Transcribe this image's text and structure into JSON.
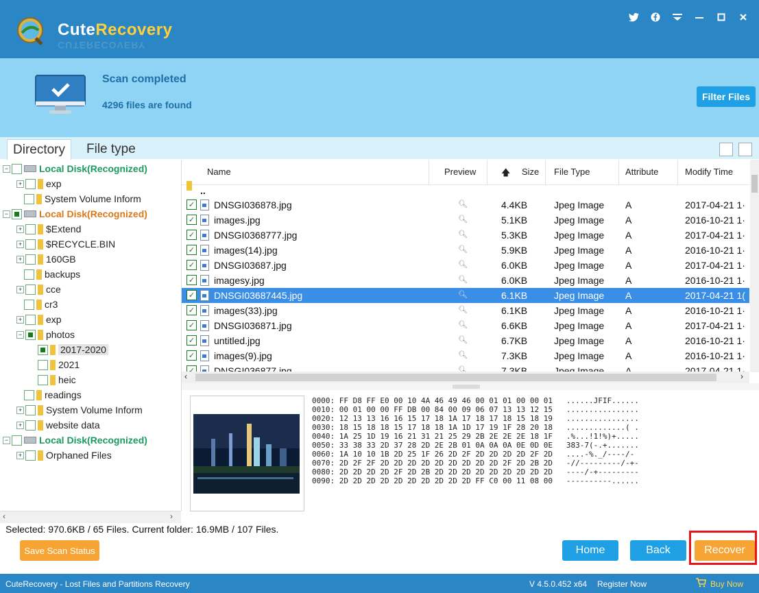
{
  "window": {
    "app_name_part1": "Cute",
    "app_name_part2": "Recovery",
    "app_name_shadow": "CUTERECOVERY",
    "controls": [
      "twitter-icon",
      "facebook-icon",
      "menu-icon",
      "minimize-icon",
      "maximize-icon",
      "close-icon"
    ]
  },
  "scan": {
    "status": "Scan completed",
    "count": "4296 files are found",
    "filter_button": "Filter Files"
  },
  "tabs": {
    "directory": "Directory",
    "file_type": "File type"
  },
  "tree": [
    {
      "label": "Local Disk(Recognized)",
      "kind": "disk",
      "color": "green",
      "indent": 0,
      "exp": "−",
      "check": "none"
    },
    {
      "label": "exp",
      "kind": "folder",
      "indent": 1,
      "exp": "+",
      "check": "none"
    },
    {
      "label": "System Volume Inform",
      "kind": "folder",
      "indent": 1,
      "exp": "",
      "check": "none"
    },
    {
      "label": "Local Disk(Recognized)",
      "kind": "disk",
      "color": "orange",
      "indent": 0,
      "exp": "−",
      "check": "partial"
    },
    {
      "label": "$Extend",
      "kind": "folder",
      "indent": 1,
      "exp": "+",
      "check": "none"
    },
    {
      "label": "$RECYCLE.BIN",
      "kind": "folder",
      "indent": 1,
      "exp": "+",
      "check": "none"
    },
    {
      "label": "160GB",
      "kind": "folder",
      "indent": 1,
      "exp": "+",
      "check": "none"
    },
    {
      "label": "backups",
      "kind": "folder",
      "indent": 1,
      "exp": "",
      "check": "none"
    },
    {
      "label": "cce",
      "kind": "folder",
      "indent": 1,
      "exp": "+",
      "check": "none"
    },
    {
      "label": "cr3",
      "kind": "folder",
      "indent": 1,
      "exp": "",
      "check": "none"
    },
    {
      "label": "exp",
      "kind": "folder",
      "indent": 1,
      "exp": "+",
      "check": "none"
    },
    {
      "label": "photos",
      "kind": "folder",
      "indent": 1,
      "exp": "−",
      "check": "partial"
    },
    {
      "label": "2017-2020",
      "kind": "folder",
      "indent": 2,
      "exp": "",
      "check": "partial",
      "selected": true
    },
    {
      "label": "2021",
      "kind": "folder",
      "indent": 2,
      "exp": "",
      "check": "none"
    },
    {
      "label": "heic",
      "kind": "folder",
      "indent": 2,
      "exp": "",
      "check": "none"
    },
    {
      "label": "readings",
      "kind": "folder",
      "indent": 1,
      "exp": "",
      "check": "none"
    },
    {
      "label": "System Volume Inform",
      "kind": "folder",
      "indent": 1,
      "exp": "+",
      "check": "none"
    },
    {
      "label": "website data",
      "kind": "folder",
      "indent": 1,
      "exp": "+",
      "check": "none"
    },
    {
      "label": "Local Disk(Recognized)",
      "kind": "disk",
      "color": "green",
      "indent": 0,
      "exp": "−",
      "check": "none"
    },
    {
      "label": "Orphaned Files",
      "kind": "folder",
      "indent": 1,
      "exp": "+",
      "check": "none"
    }
  ],
  "grid": {
    "columns": {
      "name": "Name",
      "preview": "Preview",
      "size": "Size",
      "type": "File Type",
      "attr": "Attribute",
      "modified": "Modify Time"
    },
    "parent_label": "..",
    "rows": [
      {
        "name": "DNSGI036878.jpg",
        "size": "4.4KB",
        "type": "Jpeg Image",
        "attr": "A",
        "modified": "2017-04-21 1·"
      },
      {
        "name": "images.jpg",
        "size": "5.1KB",
        "type": "Jpeg Image",
        "attr": "A",
        "modified": "2016-10-21 1·"
      },
      {
        "name": "DNSGI0368777.jpg",
        "size": "5.3KB",
        "type": "Jpeg Image",
        "attr": "A",
        "modified": "2017-04-21 1·"
      },
      {
        "name": "images(14).jpg",
        "size": "5.9KB",
        "type": "Jpeg Image",
        "attr": "A",
        "modified": "2016-10-21 1·"
      },
      {
        "name": "DNSGI03687.jpg",
        "size": "6.0KB",
        "type": "Jpeg Image",
        "attr": "A",
        "modified": "2017-04-21 1·"
      },
      {
        "name": "imagesy.jpg",
        "size": "6.0KB",
        "type": "Jpeg Image",
        "attr": "A",
        "modified": "2016-10-21 1·"
      },
      {
        "name": "DNSGI03687445.jpg",
        "size": "6.1KB",
        "type": "Jpeg Image",
        "attr": "A",
        "modified": "2017-04-21 1(",
        "selected": true
      },
      {
        "name": "images(33).jpg",
        "size": "6.1KB",
        "type": "Jpeg Image",
        "attr": "A",
        "modified": "2016-10-21 1·"
      },
      {
        "name": "DNSGI036871.jpg",
        "size": "6.6KB",
        "type": "Jpeg Image",
        "attr": "A",
        "modified": "2017-04-21 1·"
      },
      {
        "name": "untitled.jpg",
        "size": "6.7KB",
        "type": "Jpeg Image",
        "attr": "A",
        "modified": "2016-10-21 1·"
      },
      {
        "name": "images(9).jpg",
        "size": "7.3KB",
        "type": "Jpeg Image",
        "attr": "A",
        "modified": "2016-10-21 1·"
      },
      {
        "name": "DNSGI036877.jpg",
        "size": "7.3KB",
        "type": "Jpeg Image",
        "attr": "A",
        "modified": "2017-04-21 1·"
      }
    ]
  },
  "hex_dump": [
    "0000: FF D8 FF E0 00 10 4A 46 49 46 00 01 01 00 00 01   ......JFIF......",
    "0010: 00 01 00 00 FF DB 00 84 00 09 06 07 13 13 12 15   ................",
    "0020: 12 13 13 16 16 15 17 18 1A 17 18 17 18 15 18 19   ................",
    "0030: 18 15 18 18 15 17 18 18 1A 1D 17 19 1F 28 20 18   .............( .",
    "0040: 1A 25 1D 19 16 21 31 21 25 29 2B 2E 2E 2E 18 1F   .%...!1!%)+.....",
    "0050: 33 38 33 2D 37 28 2D 2E 2B 01 0A 0A 0A 0E 0D 0E   383-7(-.+.......",
    "0060: 1A 10 10 1B 2D 25 1F 26 2D 2F 2D 2D 2D 2D 2F 2D   ....-%._/----/-",
    "0070: 2D 2F 2F 2D 2D 2D 2D 2D 2D 2D 2D 2D 2F 2D 2B 2D   -//---------/-+-",
    "0080: 2D 2D 2D 2D 2F 2D 2B 2D 2D 2D 2D 2D 2D 2D 2D 2D   ----/-+---------",
    "0090: 2D 2D 2D 2D 2D 2D 2D 2D 2D 2D FF C0 00 11 08 00   ----------......"
  ],
  "status": "Selected: 970.6KB / 65 Files.  Current folder: 16.9MB / 107 Files.",
  "buttons": {
    "save_scan": "Save Scan Status",
    "home": "Home",
    "back": "Back",
    "recover": "Recover"
  },
  "footer": {
    "left": "CuteRecovery - Lost Files and Partitions Recovery",
    "version": "V 4.5.0.452 x64",
    "register": "Register Now",
    "buy": "Buy Now"
  },
  "colors": {
    "title_bar": "#2b86c6",
    "scan_bar": "#8fd4f4",
    "accent_blue": "#1fa0e4",
    "orange": "#f6a534",
    "selected_row": "#3a8ee6",
    "highlight_red": "#e8141c"
  }
}
